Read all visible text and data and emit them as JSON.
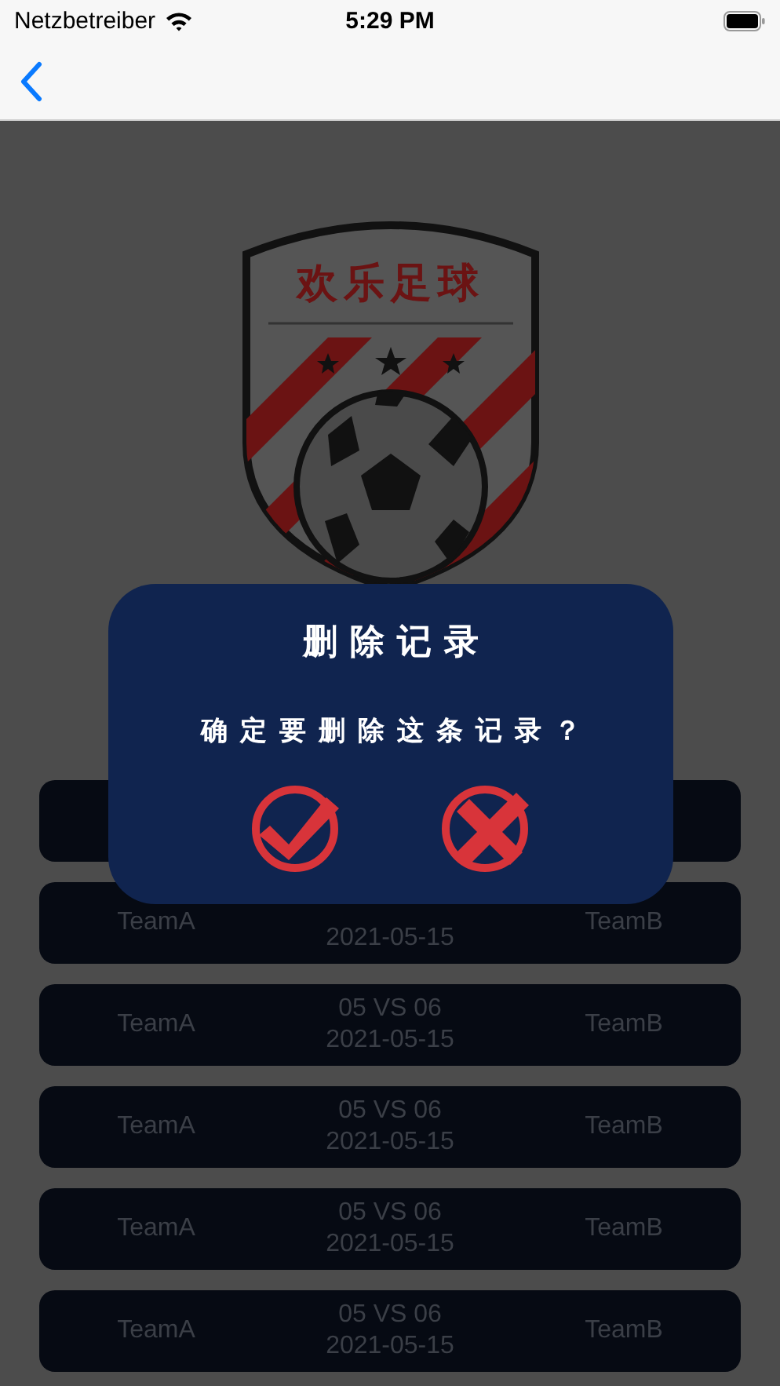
{
  "status_bar": {
    "carrier": "Netzbetreiber",
    "time": "5:29 PM"
  },
  "logo": {
    "text": "欢乐足球"
  },
  "matches": [
    {
      "kind": "blank"
    },
    {
      "kind": "match",
      "team_a": "TeamA",
      "date": "2021-05-15",
      "team_b": "TeamB"
    },
    {
      "kind": "match",
      "team_a": "TeamA",
      "match": "05 VS 06",
      "date": "2021-05-15",
      "team_b": "TeamB"
    },
    {
      "kind": "match",
      "team_a": "TeamA",
      "match": "05 VS 06",
      "date": "2021-05-15",
      "team_b": "TeamB"
    },
    {
      "kind": "match",
      "team_a": "TeamA",
      "match": "05 VS 06",
      "date": "2021-05-15",
      "team_b": "TeamB"
    },
    {
      "kind": "match",
      "team_a": "TeamA",
      "match": "05 VS 06",
      "date": "2021-05-15",
      "team_b": "TeamB"
    }
  ],
  "dialog": {
    "title": "删除记录",
    "message": "确定要删除这条记录？",
    "buttons": [
      {
        "kind": "confirm"
      },
      {
        "kind": "cancel"
      }
    ]
  }
}
